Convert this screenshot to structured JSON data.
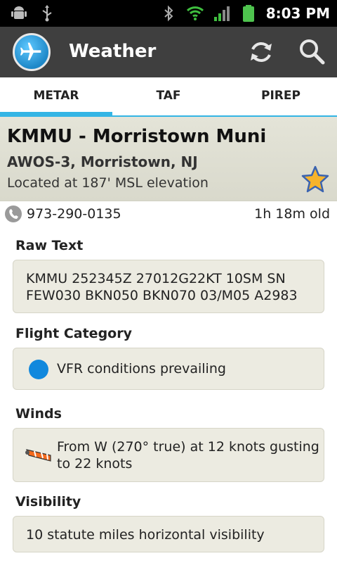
{
  "status_bar": {
    "time": "8:03 PM",
    "icons": [
      "android-debug-icon",
      "usb-icon",
      "bluetooth-icon",
      "wifi-icon",
      "signal-icon",
      "battery-icon"
    ]
  },
  "action_bar": {
    "title": "Weather",
    "icons": [
      "airplane-logo-icon",
      "refresh-icon",
      "search-icon"
    ]
  },
  "tabs": [
    {
      "label": "METAR",
      "active": true
    },
    {
      "label": "TAF",
      "active": false
    },
    {
      "label": "PIREP",
      "active": false
    }
  ],
  "station": {
    "name": "KMMU - Morristown Muni",
    "subtitle": "AWOS-3, Morristown, NJ",
    "elevation": "Located at 187' MSL elevation",
    "favorite_icon": "star-icon"
  },
  "contact": {
    "phone": "973-290-0135",
    "age": "1h 18m old"
  },
  "sections": {
    "raw_text": {
      "label": "Raw Text",
      "line1": "KMMU 252345Z 27012G22KT 10SM SN",
      "line2": "FEW030 BKN050 BKN070 03/M05 A2983"
    },
    "flight_category": {
      "label": "Flight Category",
      "value": "VFR conditions prevailing",
      "color": "#1188dd"
    },
    "winds": {
      "label": "Winds",
      "line1": "From W (270° true) at 12 knots gusting",
      "line2": "to 22 knots"
    },
    "visibility": {
      "label": "Visibility",
      "value": "10 statute miles horizontal visibility"
    }
  },
  "colors": {
    "accent": "#33b5e5",
    "action_bar": "#3f3f3f",
    "card": "#ecebe1"
  }
}
